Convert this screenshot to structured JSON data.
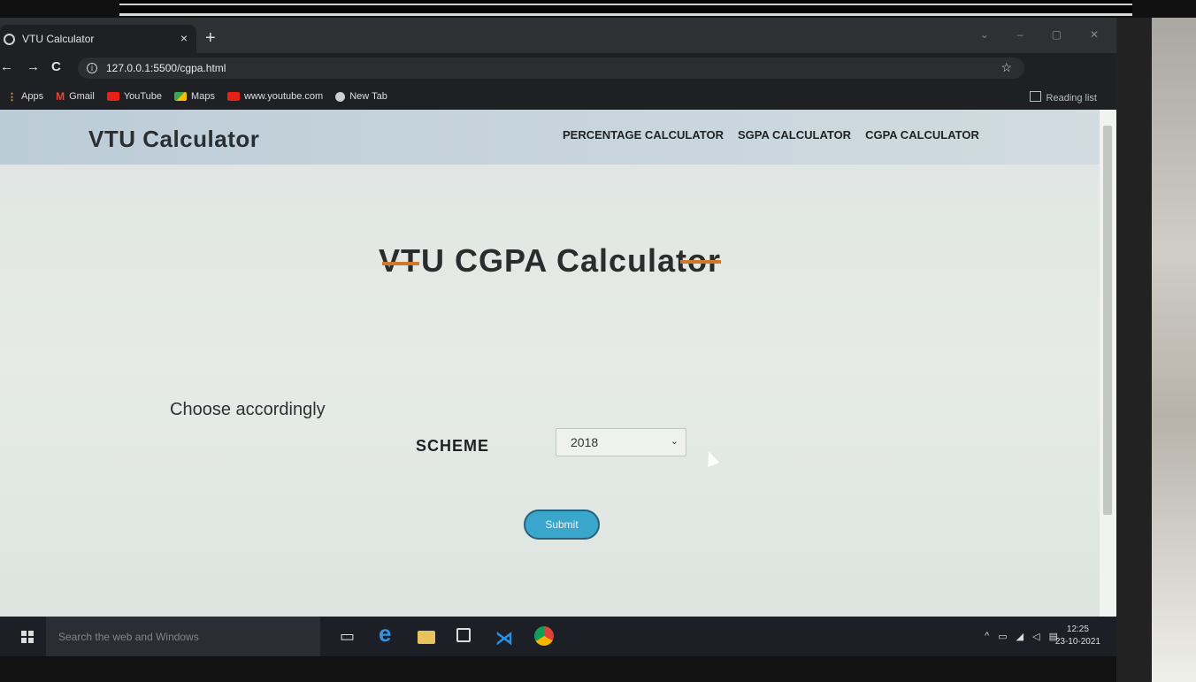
{
  "browser": {
    "tab_title": "VTU Calculator",
    "tab_close": "×",
    "new_tab": "+",
    "url": "127.0.0.1:5500/cgpa.html",
    "reading_list": "Reading list",
    "bookmarks": [
      "Apps",
      "Gmail",
      "YouTube",
      "Maps",
      "www.youtube.com",
      "New Tab"
    ]
  },
  "nav": {
    "brand": "VTU Calculator",
    "links": [
      "PERCENTAGE CALCULATOR",
      "SGPA CALCULATOR",
      "CGPA CALCULATOR"
    ]
  },
  "main": {
    "heading": "VTU CGPA Calculator",
    "choose_text": "Choose accordingly",
    "scheme_label": "SCHEME",
    "scheme_value": "2018",
    "submit_label": "Submit"
  },
  "taskbar": {
    "search_placeholder": "Search the web and Windows",
    "time": "12:25",
    "date": "23-10-2021"
  },
  "colors": {
    "accent_bar": "#d4762a",
    "submit_bg": "#3aa6cc",
    "navbar_bg": "#c8d5dd"
  }
}
